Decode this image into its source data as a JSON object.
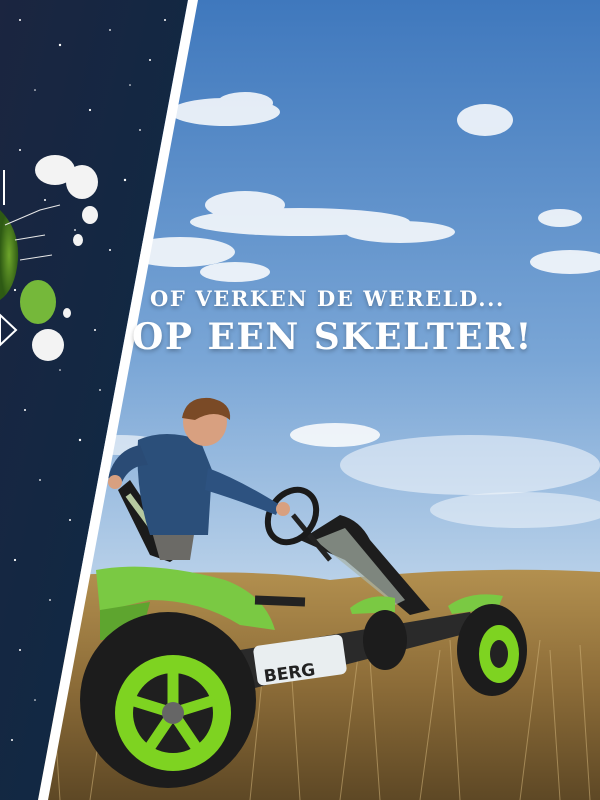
{
  "headline": {
    "line1": "OF VERKEN DE WERELD...",
    "line2": "OP EEN SKELTER!"
  },
  "kart": {
    "brand": "BERG"
  },
  "colors": {
    "sky_top": "#4d83c4",
    "sky_bottom": "#d9e6f1",
    "accent_green": "#7ed321",
    "grass": "#a5854a",
    "space_bg": "#0d1a33"
  }
}
